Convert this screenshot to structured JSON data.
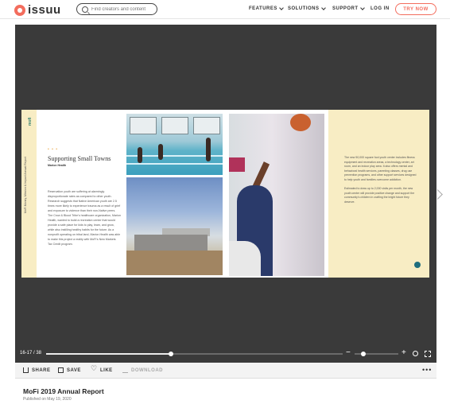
{
  "nav": {
    "logo_text": "issuu",
    "search_placeholder": "Find creators and content",
    "features": "FEATURES",
    "solutions": "SOLUTIONS",
    "support": "SUPPORT",
    "login": "LOG IN",
    "try_now": "TRY NOW"
  },
  "page_left": {
    "side_mark": "mofi",
    "side_text": "MoFi Money, Mission & Impact Annual Report",
    "dots": "• • •",
    "heading": "Supporting Small Towns",
    "subhead": "Marion Health",
    "body": "Reservation youth are suffering at alarmingly disproportionate rates as compared to other youth. Research suggests that Native American youth are 2.5 times more likely to experience trauma as a result of grief and exposure to violence than their non-Native peers. The Crow & Blood Tribe's healthcare organization, Marion Health, wanted to build a recreation center that would provide a safe place for kids to play, learn, and grow, while also instilling healthy habits for the future. As a nonprofit operating on tribal land, Marion Health was able to make this project a reality with MoFi's New Markets Tax Credit program."
  },
  "page_right": {
    "para1": "The new 50,000 square foot youth center includes fitness equipment and recreation areas, a technology center, art room, and an indoor play area. It also offers mental and behavioral health services, parenting classes, drug use prevention programs, and other support services designed to help youth and families overcome addiction.",
    "para2": "Estimated to draw up to 2,000 visits per month, the new youth center will provide positive change and support the community's children in crafting the bright future they deserve."
  },
  "controls": {
    "page_indicator": "16-17 / 38",
    "progress_fraction": 0.42,
    "zoom_fraction": 0.2,
    "zoom_minus": "−",
    "zoom_plus": "+"
  },
  "actions": {
    "share": "SHARE",
    "save": "SAVE",
    "like": "LIKE",
    "download": "DOWNLOAD",
    "more": "•••"
  },
  "document": {
    "title": "MoFi 2019 Annual Report",
    "published": "Published on May 19, 2020"
  },
  "colors": {
    "brand": "#f36d5d",
    "reader_bg": "#3a3a3a",
    "page_cream": "#f8edc4",
    "accent_teal": "#1f6e7d"
  }
}
